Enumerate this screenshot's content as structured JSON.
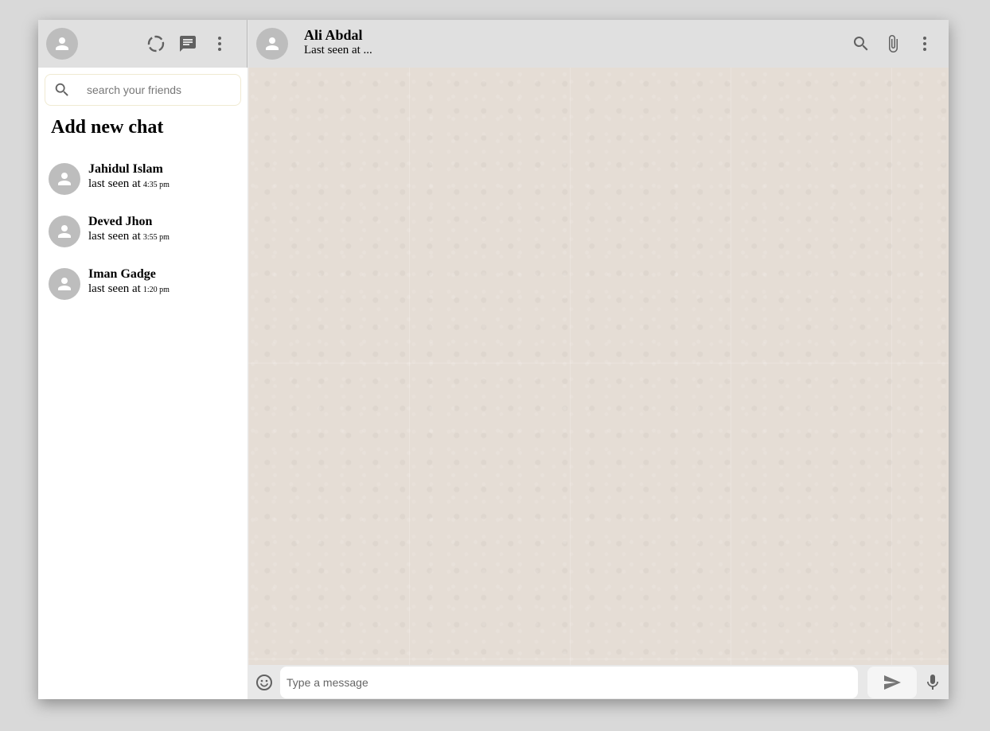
{
  "sidebar": {
    "search": {
      "placeholder": "search your friends"
    },
    "add_chat_label": "Add new chat",
    "chats": [
      {
        "name": "Jahidul Islam",
        "seen_label": "last seen at",
        "time": "4:35 pm"
      },
      {
        "name": "Deved Jhon",
        "seen_label": "last seen at",
        "time": "3:55 pm"
      },
      {
        "name": "Iman Gadge",
        "seen_label": "last seen at",
        "time": "1:20 pm"
      }
    ],
    "header_icons": [
      "status-icon",
      "chat-icon",
      "more-vert-icon"
    ]
  },
  "main": {
    "contact": {
      "name": "Ali Abdal",
      "last_seen": "Last seen at ..."
    },
    "header_icons": [
      "search-icon",
      "attach-icon",
      "more-vert-icon"
    ],
    "footer": {
      "message_placeholder": "Type a message",
      "icons": [
        "emoji-icon",
        "send-icon",
        "mic-icon"
      ]
    }
  },
  "colors": {
    "header_bg": "#e0e0e0",
    "avatar_bg": "#bdbdbd",
    "icon_color": "#616161",
    "chat_bg": "#e5ddd5"
  }
}
